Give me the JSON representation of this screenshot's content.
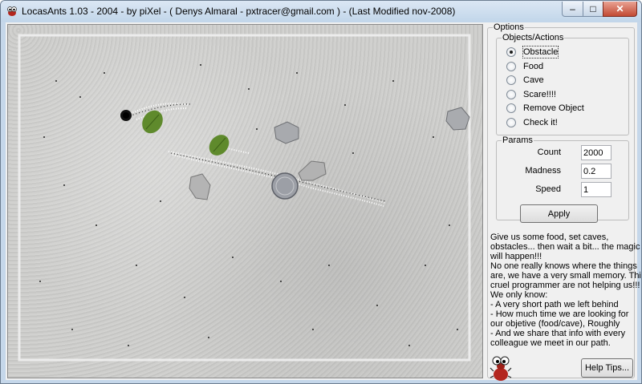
{
  "window": {
    "title": "LocasAnts 1.03 - 2004  - by piXel - ( Denys Almaral - pxtracer@gmail.com ) - (Last Modified nov-2008)",
    "controls": {
      "minimize": "–",
      "maximize": "□",
      "close": "✕"
    }
  },
  "colors": {
    "titlebar": "#c5d7ea",
    "close_button": "#c24a33",
    "terrain": "#cacac8"
  },
  "options": {
    "title": "Options",
    "objects_actions": {
      "title": "Objects/Actions",
      "items": [
        {
          "label": "Obstacle",
          "checked": true
        },
        {
          "label": "Food",
          "checked": false
        },
        {
          "label": "Cave",
          "checked": false
        },
        {
          "label": "Scare!!!!",
          "checked": false
        },
        {
          "label": "Remove Object",
          "checked": false
        },
        {
          "label": "Check it!",
          "checked": false
        }
      ]
    },
    "params": {
      "title": "Params",
      "count_label": "Count",
      "count_value": "2000",
      "madness_label": "Madness",
      "madness_value": "0.2",
      "speed_label": "Speed",
      "speed_value": "1"
    },
    "apply_label": "Apply"
  },
  "info_lines": [
    "Give us some food, set caves,",
    "obstacles... then wait a bit... the magic",
    "will happen!!!",
    "No one really knows where the things",
    "are, we have a very small memory. This",
    "cruel programmer are not helping us!!!",
    "We only know:",
    " - A very short path we left behind",
    " - How much time we are looking for",
    "our objetive (food/cave), Roughly",
    " - And we share that info with every",
    "colleague we meet in our path."
  ],
  "help_label": "Help Tips...",
  "icons": {
    "app": "ant-icon",
    "logo": "ant-logo-icon"
  }
}
